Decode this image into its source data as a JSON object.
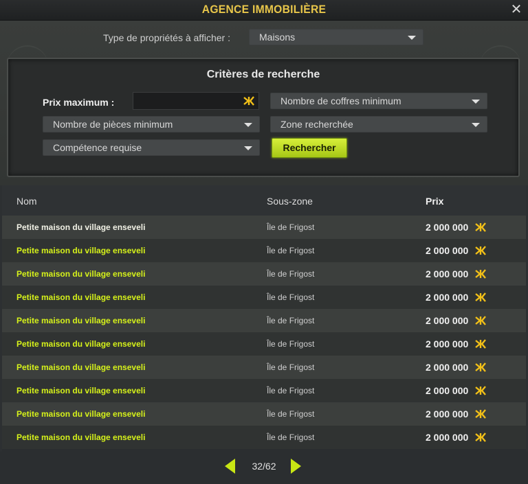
{
  "window": {
    "title": "AGENCE IMMOBILIÈRE",
    "close_glyph": "✕"
  },
  "type_selector": {
    "label": "Type de propriétés à afficher :",
    "value": "Maisons"
  },
  "criteria": {
    "title": "Critères de recherche",
    "prix_label": "Prix maximum :",
    "prix_value": "",
    "coffres": "Nombre de coffres minimum",
    "pieces": "Nombre de pièces minimum",
    "zone": "Zone recherchée",
    "competence": "Compétence requise",
    "search_button": "Rechercher"
  },
  "table": {
    "headers": {
      "name": "Nom",
      "zone": "Sous-zone",
      "price": "Prix"
    },
    "rows": [
      {
        "name": "Petite maison du village enseveli",
        "zone": "Île de Frigost",
        "price": "2 000 000"
      },
      {
        "name": "Petite maison du village enseveli",
        "zone": "Île de Frigost",
        "price": "2 000 000"
      },
      {
        "name": "Petite maison du village enseveli",
        "zone": "Île de Frigost",
        "price": "2 000 000"
      },
      {
        "name": "Petite maison du village enseveli",
        "zone": "Île de Frigost",
        "price": "2 000 000"
      },
      {
        "name": "Petite maison du village enseveli",
        "zone": "Île de Frigost",
        "price": "2 000 000"
      },
      {
        "name": "Petite maison du village enseveli",
        "zone": "Île de Frigost",
        "price": "2 000 000"
      },
      {
        "name": "Petite maison du village enseveli",
        "zone": "Île de Frigost",
        "price": "2 000 000"
      },
      {
        "name": "Petite maison du village enseveli",
        "zone": "Île de Frigost",
        "price": "2 000 000"
      },
      {
        "name": "Petite maison du village enseveli",
        "zone": "Île de Frigost",
        "price": "2 000 000"
      },
      {
        "name": "Petite maison du village enseveli",
        "zone": "Île de Frigost",
        "price": "2 000 000"
      }
    ]
  },
  "pager": {
    "label": "32/62"
  },
  "colors": {
    "title": "#e8c64a",
    "accent": "#c8e614",
    "row_name": "#d6f21a",
    "kama": "#f2c018"
  },
  "icons": {
    "currency": "kama-icon",
    "dropdown": "chevron-down-icon",
    "prev": "arrow-left-icon",
    "next": "arrow-right-icon",
    "close": "close-icon"
  }
}
